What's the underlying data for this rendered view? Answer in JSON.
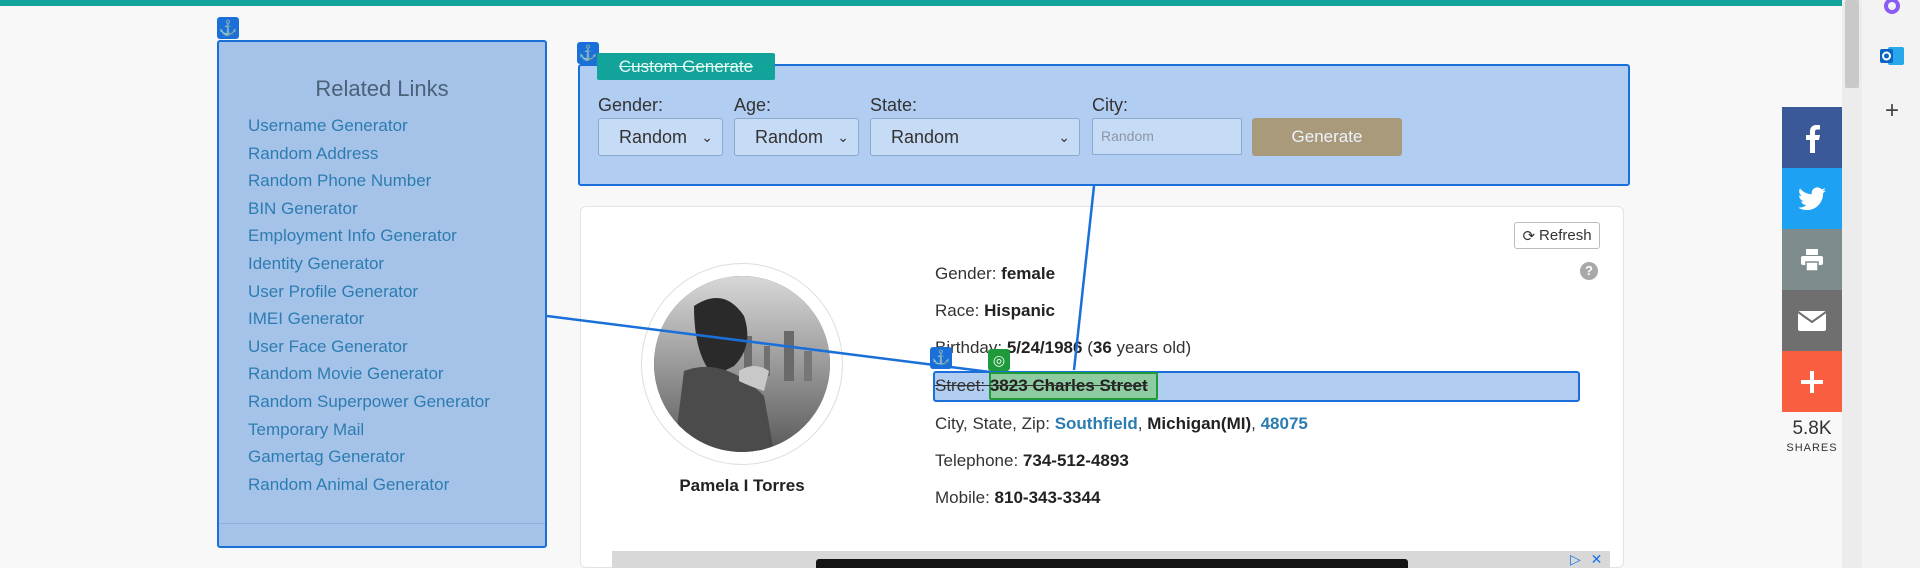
{
  "related": {
    "title": "Related Links",
    "links": [
      "Username Generator",
      "Random Address",
      "Random Phone Number",
      "BIN Generator",
      "Employment Info Generator",
      "Identity Generator",
      "User Profile Generator",
      "IMEI Generator",
      "User Face Generator",
      "Random Movie Generator",
      "Random Superpower Generator",
      "Temporary Mail",
      "Gamertag Generator",
      "Random Animal Generator"
    ]
  },
  "generate": {
    "tab_label": "Custom Generate",
    "gender_label": "Gender:",
    "gender_value": "Random",
    "age_label": "Age:",
    "age_value": "Random",
    "state_label": "State:",
    "state_value": "Random",
    "city_label": "City:",
    "city_placeholder": "Random",
    "button_label": "Generate"
  },
  "profile": {
    "refresh_label": "Refresh",
    "help_symbol": "?",
    "name": "Pamela I Torres",
    "gender_label": "Gender:",
    "gender": "female",
    "race_label": "Race:",
    "race": "Hispanic",
    "birthday_label": "Birthday:",
    "birthday": "5/24/1986",
    "age": "36",
    "age_suffix": "years old)",
    "street_label": "Street:",
    "street": "3823 Charles Street",
    "csz_label": "City, State, Zip:",
    "city": "Southfield",
    "state": "Michigan(MI)",
    "zip": "48075",
    "telephone_label": "Telephone:",
    "telephone": "734-512-4893",
    "mobile_label": "Mobile:",
    "mobile": "810-343-3344"
  },
  "share": {
    "count": "5.8K",
    "label": "SHARES",
    "facebook_color": "#3b5998",
    "twitter_color": "#1da1f2",
    "print_color": "#7f8c8d",
    "email_color": "#6f6f6f",
    "more_color": "#fa5e41"
  },
  "accent_color": "#12a39a",
  "icons": [
    "anchor-icon",
    "target-icon",
    "facebook-icon",
    "twitter-icon",
    "print-icon",
    "email-icon",
    "plus-icon",
    "refresh-icon",
    "help-icon",
    "outlook-icon",
    "copilot-icon",
    "adchoices-icon",
    "close-icon"
  ]
}
